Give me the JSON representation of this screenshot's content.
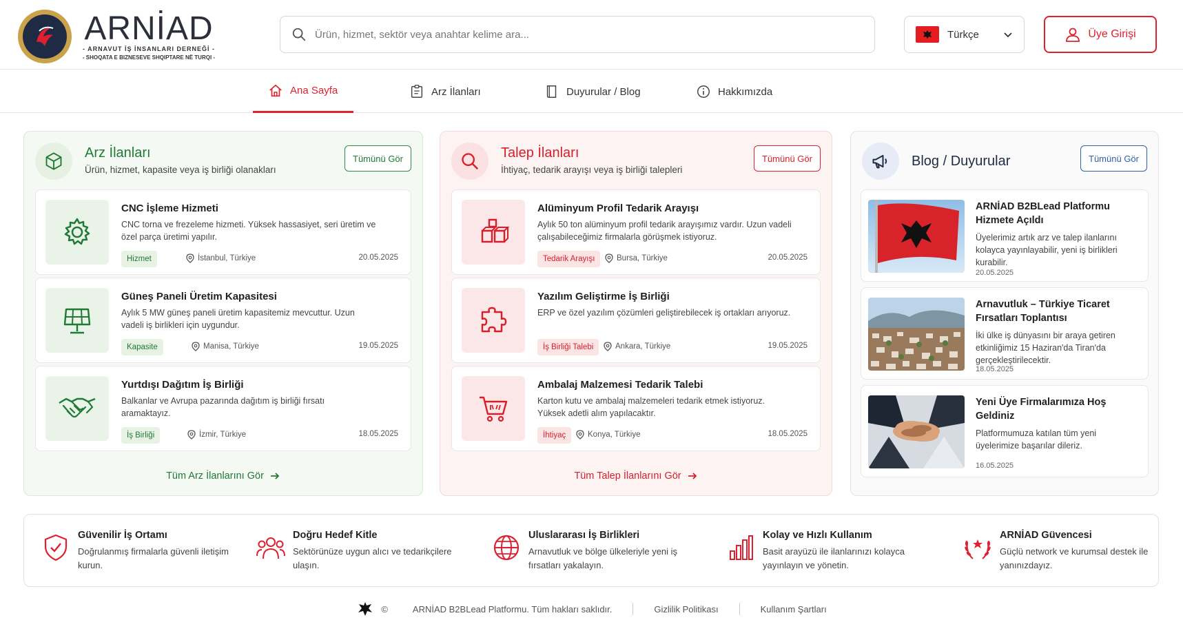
{
  "brand": {
    "name": "ARNİAD",
    "sub1": "- ARNAVUT İŞ İNSANLARI DERNEĞİ -",
    "sub2": "- SHOQATA E BIZNESEVE SHQIPTARE NË TURQI -"
  },
  "search": {
    "placeholder": "Ürün, hizmet, sektör veya anahtar kelime ara..."
  },
  "language": {
    "selected": "Türkçe"
  },
  "login": {
    "label": "Üye Girişi"
  },
  "nav": [
    {
      "label": "Ana Sayfa",
      "active": true
    },
    {
      "label": "Arz İlanları"
    },
    {
      "label": "Duyurular / Blog"
    },
    {
      "label": "Hakkımızda"
    }
  ],
  "offers": {
    "title": "Arz İlanları",
    "subtitle": "Ürün, hizmet, kapasite veya iş birliği olanakları",
    "see_all": "Tümünü Gör",
    "all_link": "Tüm Arz İlanlarını Gör",
    "items": [
      {
        "title": "CNC İşleme Hizmeti",
        "desc": "CNC torna ve frezeleme hizmeti. Yüksek hassasiyet, seri üretim ve özel parça üretimi yapılır.",
        "tag": "Hizmet",
        "location": "İstanbul, Türkiye",
        "date": "20.05.2025",
        "icon": "gear-icon"
      },
      {
        "title": "Güneş Paneli Üretim Kapasitesi",
        "desc": "Aylık 5 MW güneş paneli üretim kapasitemiz mevcuttur. Uzun vadeli iş birlikleri için uygundur.",
        "tag": "Kapasite",
        "location": "Manisa, Türkiye",
        "date": "19.05.2025",
        "icon": "solar-panel-icon"
      },
      {
        "title": "Yurtdışı Dağıtım İş Birliği",
        "desc": "Balkanlar ve Avrupa pazarında dağıtım iş birliği fırsatı aramaktayız.",
        "tag": "İş Birliği",
        "location": "İzmir, Türkiye",
        "date": "18.05.2025",
        "icon": "handshake-icon"
      }
    ]
  },
  "requests": {
    "title": "Talep İlanları",
    "subtitle": "İhtiyaç, tedarik arayışı veya iş birliği talepleri",
    "see_all": "Tümünü Gör",
    "all_link": "Tüm Talep İlanlarını Gör",
    "items": [
      {
        "title": "Alüminyum Profil Tedarik Arayışı",
        "desc": "Aylık 50 ton alüminyum profil tedarik arayışımız vardır. Uzun vadeli çalışabileceğimiz firmalarla görüşmek istiyoruz.",
        "tag": "Tedarik Arayışı",
        "location": "Bursa, Türkiye",
        "date": "20.05.2025",
        "icon": "boxes-icon"
      },
      {
        "title": "Yazılım Geliştirme İş Birliği",
        "desc": "ERP ve özel yazılım çözümleri geliştirebilecek iş ortakları arıyoruz.",
        "tag": "İş Birliği Talebi",
        "location": "Ankara, Türkiye",
        "date": "19.05.2025",
        "icon": "puzzle-icon"
      },
      {
        "title": "Ambalaj Malzemesi Tedarik Talebi",
        "desc": "Karton kutu ve ambalaj malzemeleri tedarik etmek istiyoruz. Yüksek adetli alım yapılacaktır.",
        "tag": "İhtiyaç",
        "location": "Konya, Türkiye",
        "date": "18.05.2025",
        "icon": "cart-icon"
      }
    ]
  },
  "blog": {
    "title": "Blog / Duyurular",
    "see_all": "Tümünü Gör",
    "items": [
      {
        "title": "ARNİAD B2BLead Platformu Hizmete Açıldı",
        "desc": "Üyelerimiz artık arz ve talep ilanlarını kolayca yayınlayabilir, yeni iş birlikleri kurabilir.",
        "date": "20.05.2025"
      },
      {
        "title": "Arnavutluk – Türkiye Ticaret Fırsatları Toplantısı",
        "desc": "İki ülke iş dünyasını bir araya getiren etkinliğimiz 15 Haziran'da Tiran'da gerçekleştirilecektir.",
        "date": "18.05.2025"
      },
      {
        "title": "Yeni Üye Firmalarımıza Hoş Geldiniz",
        "desc": "Platformumuza katılan tüm yeni üyelerimize başarılar dileriz.",
        "date": "16.05.2025"
      }
    ]
  },
  "features": [
    {
      "title": "Güvenilir İş Ortamı",
      "desc": "Doğrulanmış firmalarla güvenli iletişim kurun.",
      "icon": "shield-check-icon"
    },
    {
      "title": "Doğru Hedef Kitle",
      "desc": "Sektörünüze uygun alıcı ve tedarikçilere ulaşın.",
      "icon": "users-icon"
    },
    {
      "title": "Uluslararası İş Birlikleri",
      "desc": "Arnavutluk ve bölge ülkeleriyle yeni iş fırsatları yakalayın.",
      "icon": "globe-icon"
    },
    {
      "title": "Kolay ve Hızlı Kullanım",
      "desc": "Basit arayüzü ile ilanlarınızı kolayca yayınlayın ve yönetin.",
      "icon": "bar-chart-icon"
    },
    {
      "title": "ARNİAD Güvencesi",
      "desc": "Güçlü network ve kurumsal destek ile yanınızdayız.",
      "icon": "laurel-icon"
    }
  ],
  "footer": {
    "copyright_symbol": "©",
    "copyright": "ARNİAD B2BLead Platformu. Tüm hakları saklıdır.",
    "privacy": "Gizlilik Politikası",
    "terms": "Kullanım Şartları"
  },
  "colors": {
    "green": "#1e7a34",
    "red": "#e0202e",
    "navy": "#1f2a44"
  }
}
